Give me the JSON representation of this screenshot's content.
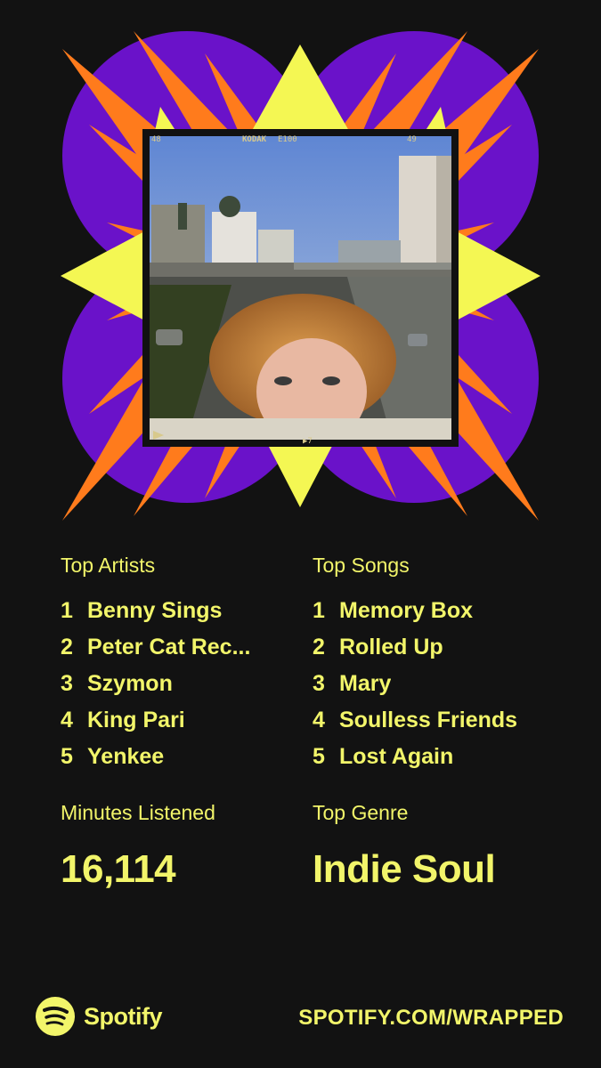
{
  "colors": {
    "background": "#121212",
    "accent": "#f2f56a",
    "purple": "#6a12c9",
    "orange": "#ff7b1c",
    "yellow": "#f4f753"
  },
  "artwork": {
    "icon": "starburst-photo-frame",
    "film_frame_left": "48",
    "film_brand": "KODAK",
    "film_type": "E100",
    "film_frame_right": "49",
    "film_bottom_mark": "▶7"
  },
  "top_artists": {
    "label": "Top Artists",
    "items": [
      {
        "rank": "1",
        "name": "Benny Sings"
      },
      {
        "rank": "2",
        "name": "Peter Cat Rec..."
      },
      {
        "rank": "3",
        "name": "Szymon"
      },
      {
        "rank": "4",
        "name": "King Pari"
      },
      {
        "rank": "5",
        "name": "Yenkee"
      }
    ]
  },
  "top_songs": {
    "label": "Top Songs",
    "items": [
      {
        "rank": "1",
        "name": "Memory Box"
      },
      {
        "rank": "2",
        "name": "Rolled Up"
      },
      {
        "rank": "3",
        "name": "Mary"
      },
      {
        "rank": "4",
        "name": "Soulless Friends"
      },
      {
        "rank": "5",
        "name": "Lost Again"
      }
    ]
  },
  "minutes": {
    "label": "Minutes Listened",
    "value": "16,114"
  },
  "genre": {
    "label": "Top Genre",
    "value": "Indie Soul"
  },
  "footer": {
    "brand": "Spotify",
    "brand_icon": "spotify-logo-icon",
    "link": "SPOTIFY.COM/WRAPPED"
  }
}
